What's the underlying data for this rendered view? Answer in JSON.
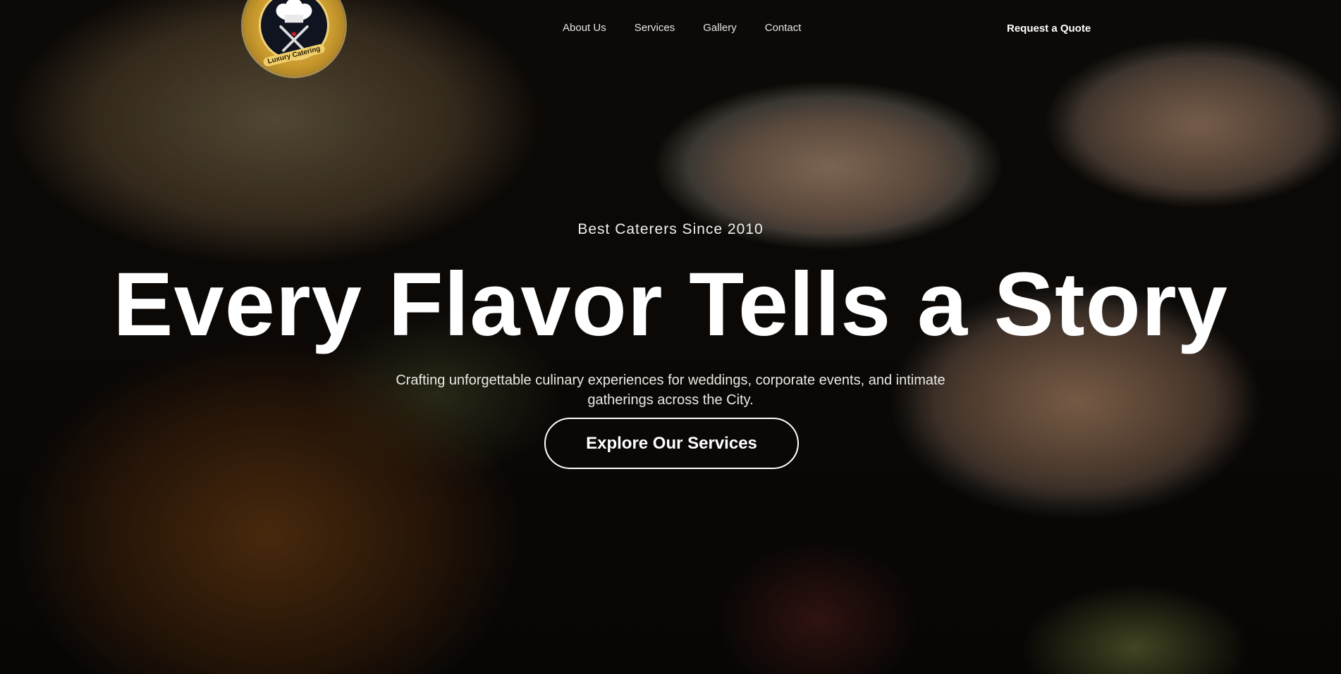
{
  "brand": {
    "logo_text": "Luxury Catering",
    "logo_icon": "chef-hat-fork-knife-emblem",
    "colors": {
      "gold": "#e8c865",
      "navy": "#0f1420"
    }
  },
  "nav": {
    "links": [
      {
        "label": "About Us"
      },
      {
        "label": "Services"
      },
      {
        "label": "Gallery"
      },
      {
        "label": "Contact"
      }
    ],
    "cta_label": "Request a Quote"
  },
  "hero": {
    "eyebrow": "Best Caterers Since 2010",
    "headline": "Every Flavor Tells a Story",
    "subtext": "Crafting unforgettable culinary experiences for weddings, corporate events, and intimate gatherings across the City.",
    "button_label": "Explore Our Services"
  }
}
